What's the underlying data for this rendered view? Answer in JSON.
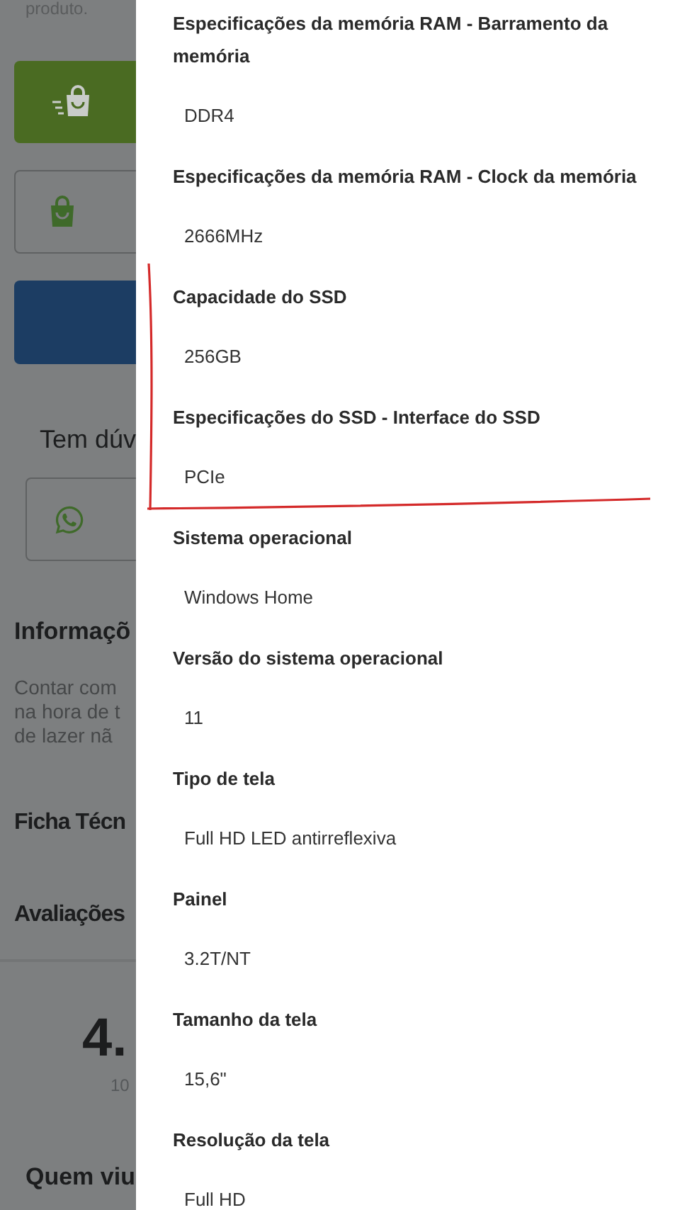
{
  "background_page": {
    "top_text": "produto.",
    "help_heading": "Tem dúv",
    "info_heading": "Informaçõ",
    "info_lines": [
      "Contar com",
      "na hora de t",
      "de lazer nã"
    ],
    "tech_heading": "Ficha Técn",
    "reviews_heading": "Avaliações",
    "rating": "4.",
    "review_count": "10",
    "seen_heading": "Quem viu"
  },
  "specs": [
    {
      "name": "Especificações da memória RAM - Barramento da memória",
      "value": "DDR4"
    },
    {
      "name": "Especificações da memória RAM - Clock da memória",
      "value": "2666MHz"
    },
    {
      "name": "Capacidade do SSD",
      "value": "256GB"
    },
    {
      "name": "Especificações do SSD - Interface do SSD",
      "value": "PCIe"
    },
    {
      "name": "Sistema operacional",
      "value": "Windows Home"
    },
    {
      "name": "Versão do sistema operacional",
      "value": "11"
    },
    {
      "name": "Tipo de tela",
      "value": "Full HD LED antirreflexiva"
    },
    {
      "name": "Painel",
      "value": "3.2T/NT"
    },
    {
      "name": "Tamanho da tela",
      "value": "15,6\""
    },
    {
      "name": "Resolução da tela",
      "value": "Full HD"
    }
  ]
}
